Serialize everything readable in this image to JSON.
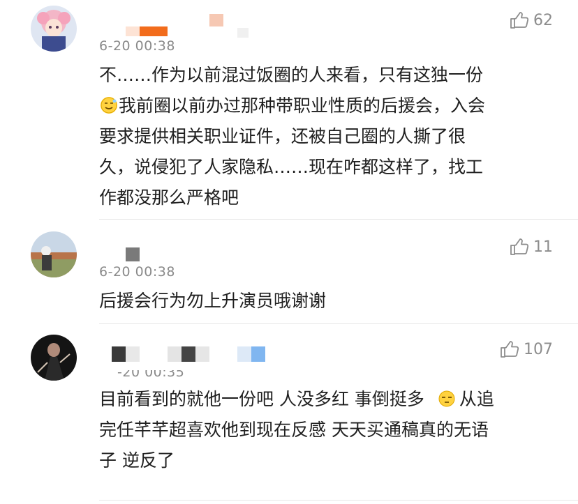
{
  "comments": [
    {
      "time": "6-20 00:38",
      "likes": "62",
      "lines": [
        "不……作为以前混过饭圈的人来看，只有这独一份",
        "我前圈以前办过那种带职业性质的后援会，入会",
        "要求提供相关职业证件，还被自己圈的人撕了很",
        "久，说侵犯了人家隐私……现在咋都这样了，找工",
        "作都没那么严格吧"
      ]
    },
    {
      "time": "6-20 00:38",
      "likes": "11",
      "lines": [
        "后援会行为勿上升演员哦谢谢"
      ]
    },
    {
      "time": "-20 00:35",
      "likes": "107",
      "lines": [
        "目前看到的就他一份吧 人没多红 事倒挺多",
        "从追",
        "完任芊芊超喜欢他到现在反感 天天买通稿真的无语",
        "子 逆反了"
      ]
    }
  ],
  "colors": {
    "meta": "#8a8a8a",
    "text": "#1f1f1f",
    "divider": "#e6e6e6"
  },
  "icons": [
    "thumbs-up-icon",
    "smirk-emoji-icon",
    "unamused-emoji-icon"
  ]
}
